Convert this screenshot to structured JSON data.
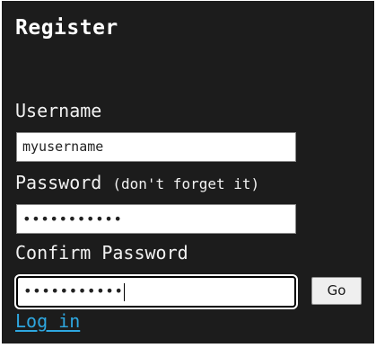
{
  "form": {
    "title": "Register",
    "username": {
      "label": "Username",
      "value": "myusername"
    },
    "password": {
      "label": "Password",
      "hint": "(don't forget it)",
      "masked_value": "•••••••••••"
    },
    "confirm_password": {
      "label": "Confirm Password",
      "masked_value": "•••••••••••",
      "focused": true
    },
    "submit_label": "Go",
    "login_link_label": "Log in"
  },
  "colors": {
    "panel_background": "#1c1c1c",
    "text": "#f2f2f2",
    "link": "#2ea7e0",
    "input_background": "#ffffff"
  }
}
